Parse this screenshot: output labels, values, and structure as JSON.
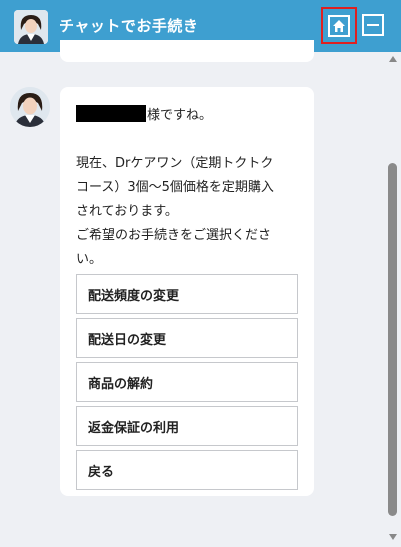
{
  "header": {
    "title": "チャットでお手続き",
    "home_icon": "home-icon",
    "minimize_icon": "minimize-icon",
    "color": "#3e9fd0",
    "highlight_color": "#e02020"
  },
  "message": {
    "name_suffix": "様ですね。",
    "line_1": "現在、Drケアワン（定期トクトク",
    "line_2": "コース）3個〜5個価格を定期購入",
    "line_3": "されております。",
    "line_4": "ご希望のお手続きをご選択くださ",
    "line_5": "い。"
  },
  "options": [
    {
      "label": "配送頻度の変更"
    },
    {
      "label": "配送日の変更"
    },
    {
      "label": "商品の解約"
    },
    {
      "label": "返金保証の利用"
    },
    {
      "label": "戻る"
    }
  ]
}
